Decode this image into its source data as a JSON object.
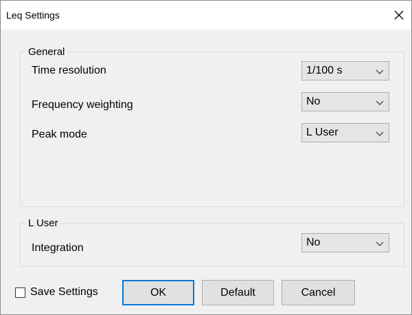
{
  "window": {
    "title": "Leq Settings"
  },
  "general": {
    "title": "General",
    "rows": [
      {
        "label": "Time resolution",
        "value": "1/100 s"
      },
      {
        "label": "Frequency weighting",
        "value": "No"
      },
      {
        "label": "Peak mode",
        "value": "L User"
      }
    ]
  },
  "luser": {
    "title": "L User",
    "rows": [
      {
        "label": "Integration",
        "value": "No"
      }
    ]
  },
  "footer": {
    "save_settings_label": "Save Settings",
    "save_settings_checked": false,
    "ok_label": "OK",
    "default_label": "Default",
    "cancel_label": "Cancel"
  },
  "icons": {
    "close": "close-icon",
    "dropdown": "chevron-down-icon"
  },
  "colors": {
    "accent": "#0078d7",
    "dialog_bg": "#f0f0f0",
    "titlebar_bg": "#ffffff"
  }
}
